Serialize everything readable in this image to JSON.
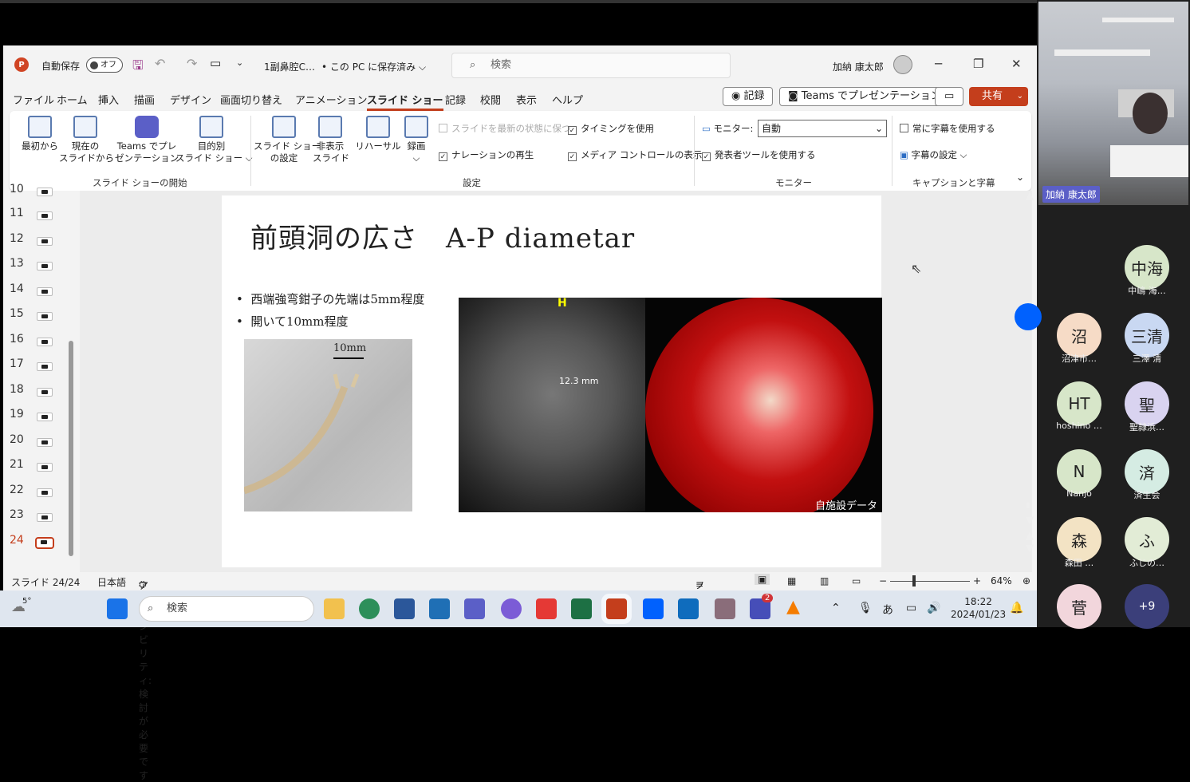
{
  "app": {
    "autosave_label": "自動保存",
    "autosave_state": "オフ",
    "file_name": "1副鼻腔C…",
    "save_status": "• この PC に保存済み ⌵",
    "search_placeholder": "検索",
    "user_name": "加納 康太郎",
    "menu": [
      "ファイル",
      "ホーム",
      "挿入",
      "描画",
      "デザイン",
      "画面切り替え",
      "アニメーション",
      "スライド ショー",
      "記録",
      "校閲",
      "表示",
      "ヘルプ"
    ],
    "active_menu_index": 7,
    "record_button": "◉ 記録",
    "teams_button": "Teams でプレゼンテーション",
    "share_button": "共有"
  },
  "ribbon": {
    "start_group": [
      "最初から",
      "現在の\nスライドから",
      "Teams でプレ\nゼンテーション",
      "目的別\nスライド ショー ⌵"
    ],
    "start_group_label": "スライド ショーの開始",
    "setup_group": [
      "スライド ショー\nの設定",
      "非表示\nスライド",
      "リハーサル",
      "録画\n⌵"
    ],
    "setup_checks": [
      {
        "label": "スライドを最新の状態に保つ",
        "checked": false,
        "disabled": true
      },
      {
        "label": "タイミングを使用",
        "checked": true,
        "disabled": false
      },
      {
        "label": "ナレーションの再生",
        "checked": true,
        "disabled": false
      },
      {
        "label": "メディア コントロールの表示",
        "checked": true,
        "disabled": false
      }
    ],
    "setup_group_label": "設定",
    "monitor_label": "モニター:",
    "monitor_value": "自動",
    "presenter_tools": "発表者ツールを使用する",
    "monitor_group_label": "モニター",
    "always_captions": "常に字幕を使用する",
    "caption_settings": "字幕の設定 ⌵",
    "caption_group_label": "キャプションと字幕"
  },
  "thumbnails": {
    "numbers": [
      "10",
      "11",
      "12",
      "13",
      "14",
      "15",
      "16",
      "17",
      "18",
      "19",
      "20",
      "21",
      "22",
      "23",
      "24"
    ],
    "current": "24"
  },
  "slide": {
    "title": "前頭洞の広さ　A-P diametar",
    "bullets": [
      "西端強弯鉗子の先端は5mm程度",
      "開いて10mm程度"
    ],
    "photo_label": "10mm",
    "ct_marker": "H",
    "ct_measure": "12.3 mm",
    "endo_caption": "自施設データ"
  },
  "status": {
    "slide_count": "スライド 24/24",
    "language": "日本語",
    "accessibility": "アクセシビリティ: 検討が必要です",
    "notes": "ノート",
    "zoom": "64%"
  },
  "taskbar": {
    "weather": "5°",
    "search": "検索",
    "time": "18:22",
    "date": "2024/01/23",
    "badge_count": "2",
    "ime": "あ"
  },
  "teams": {
    "video_name": "加納 康太郎",
    "participants": [
      {
        "initials": "中海",
        "name": "中嶋 海…",
        "color": "#d7e6c9"
      },
      {
        "initials": "沼",
        "name": "沼津市…",
        "color": "#f6dbc6"
      },
      {
        "initials": "三清",
        "name": "三澤 清",
        "color": "#c9d8f2"
      },
      {
        "initials": "HT",
        "name": "hoshino …",
        "color": "#d7e6c9"
      },
      {
        "initials": "聖",
        "name": "聖隷浜…",
        "color": "#d9d3f0"
      },
      {
        "initials": "N",
        "name": "Nanjo",
        "color": "#d7e6c9"
      },
      {
        "initials": "済",
        "name": "済生会",
        "color": "#d5ece3"
      },
      {
        "initials": "森",
        "name": "森田 …",
        "color": "#f3e3c4"
      },
      {
        "initials": "ふ",
        "name": "ふじの…",
        "color": "#e2ecd6"
      },
      {
        "initials": "菅",
        "name": "",
        "color": "#f2d6dc"
      }
    ],
    "more": "+9"
  }
}
